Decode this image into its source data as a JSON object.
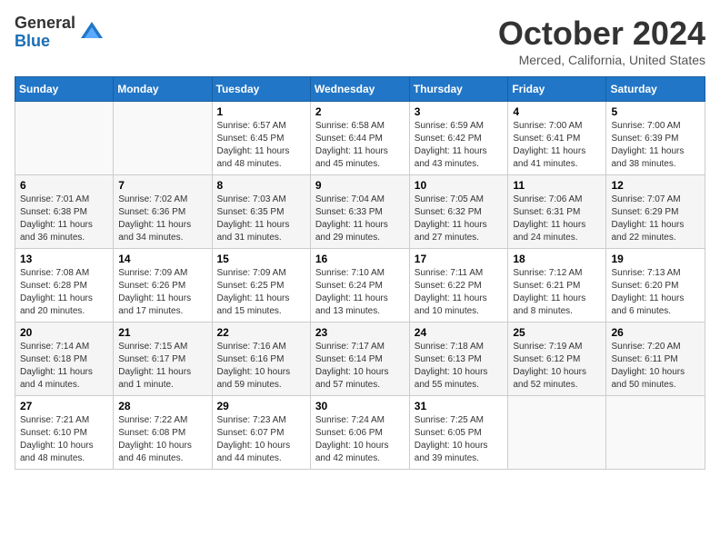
{
  "logo": {
    "general": "General",
    "blue": "Blue"
  },
  "title": "October 2024",
  "location": "Merced, California, United States",
  "weekdays": [
    "Sunday",
    "Monday",
    "Tuesday",
    "Wednesday",
    "Thursday",
    "Friday",
    "Saturday"
  ],
  "weeks": [
    [
      {
        "day": "",
        "sunrise": "",
        "sunset": "",
        "daylight": ""
      },
      {
        "day": "",
        "sunrise": "",
        "sunset": "",
        "daylight": ""
      },
      {
        "day": "1",
        "sunrise": "Sunrise: 6:57 AM",
        "sunset": "Sunset: 6:45 PM",
        "daylight": "Daylight: 11 hours and 48 minutes."
      },
      {
        "day": "2",
        "sunrise": "Sunrise: 6:58 AM",
        "sunset": "Sunset: 6:44 PM",
        "daylight": "Daylight: 11 hours and 45 minutes."
      },
      {
        "day": "3",
        "sunrise": "Sunrise: 6:59 AM",
        "sunset": "Sunset: 6:42 PM",
        "daylight": "Daylight: 11 hours and 43 minutes."
      },
      {
        "day": "4",
        "sunrise": "Sunrise: 7:00 AM",
        "sunset": "Sunset: 6:41 PM",
        "daylight": "Daylight: 11 hours and 41 minutes."
      },
      {
        "day": "5",
        "sunrise": "Sunrise: 7:00 AM",
        "sunset": "Sunset: 6:39 PM",
        "daylight": "Daylight: 11 hours and 38 minutes."
      }
    ],
    [
      {
        "day": "6",
        "sunrise": "Sunrise: 7:01 AM",
        "sunset": "Sunset: 6:38 PM",
        "daylight": "Daylight: 11 hours and 36 minutes."
      },
      {
        "day": "7",
        "sunrise": "Sunrise: 7:02 AM",
        "sunset": "Sunset: 6:36 PM",
        "daylight": "Daylight: 11 hours and 34 minutes."
      },
      {
        "day": "8",
        "sunrise": "Sunrise: 7:03 AM",
        "sunset": "Sunset: 6:35 PM",
        "daylight": "Daylight: 11 hours and 31 minutes."
      },
      {
        "day": "9",
        "sunrise": "Sunrise: 7:04 AM",
        "sunset": "Sunset: 6:33 PM",
        "daylight": "Daylight: 11 hours and 29 minutes."
      },
      {
        "day": "10",
        "sunrise": "Sunrise: 7:05 AM",
        "sunset": "Sunset: 6:32 PM",
        "daylight": "Daylight: 11 hours and 27 minutes."
      },
      {
        "day": "11",
        "sunrise": "Sunrise: 7:06 AM",
        "sunset": "Sunset: 6:31 PM",
        "daylight": "Daylight: 11 hours and 24 minutes."
      },
      {
        "day": "12",
        "sunrise": "Sunrise: 7:07 AM",
        "sunset": "Sunset: 6:29 PM",
        "daylight": "Daylight: 11 hours and 22 minutes."
      }
    ],
    [
      {
        "day": "13",
        "sunrise": "Sunrise: 7:08 AM",
        "sunset": "Sunset: 6:28 PM",
        "daylight": "Daylight: 11 hours and 20 minutes."
      },
      {
        "day": "14",
        "sunrise": "Sunrise: 7:09 AM",
        "sunset": "Sunset: 6:26 PM",
        "daylight": "Daylight: 11 hours and 17 minutes."
      },
      {
        "day": "15",
        "sunrise": "Sunrise: 7:09 AM",
        "sunset": "Sunset: 6:25 PM",
        "daylight": "Daylight: 11 hours and 15 minutes."
      },
      {
        "day": "16",
        "sunrise": "Sunrise: 7:10 AM",
        "sunset": "Sunset: 6:24 PM",
        "daylight": "Daylight: 11 hours and 13 minutes."
      },
      {
        "day": "17",
        "sunrise": "Sunrise: 7:11 AM",
        "sunset": "Sunset: 6:22 PM",
        "daylight": "Daylight: 11 hours and 10 minutes."
      },
      {
        "day": "18",
        "sunrise": "Sunrise: 7:12 AM",
        "sunset": "Sunset: 6:21 PM",
        "daylight": "Daylight: 11 hours and 8 minutes."
      },
      {
        "day": "19",
        "sunrise": "Sunrise: 7:13 AM",
        "sunset": "Sunset: 6:20 PM",
        "daylight": "Daylight: 11 hours and 6 minutes."
      }
    ],
    [
      {
        "day": "20",
        "sunrise": "Sunrise: 7:14 AM",
        "sunset": "Sunset: 6:18 PM",
        "daylight": "Daylight: 11 hours and 4 minutes."
      },
      {
        "day": "21",
        "sunrise": "Sunrise: 7:15 AM",
        "sunset": "Sunset: 6:17 PM",
        "daylight": "Daylight: 11 hours and 1 minute."
      },
      {
        "day": "22",
        "sunrise": "Sunrise: 7:16 AM",
        "sunset": "Sunset: 6:16 PM",
        "daylight": "Daylight: 10 hours and 59 minutes."
      },
      {
        "day": "23",
        "sunrise": "Sunrise: 7:17 AM",
        "sunset": "Sunset: 6:14 PM",
        "daylight": "Daylight: 10 hours and 57 minutes."
      },
      {
        "day": "24",
        "sunrise": "Sunrise: 7:18 AM",
        "sunset": "Sunset: 6:13 PM",
        "daylight": "Daylight: 10 hours and 55 minutes."
      },
      {
        "day": "25",
        "sunrise": "Sunrise: 7:19 AM",
        "sunset": "Sunset: 6:12 PM",
        "daylight": "Daylight: 10 hours and 52 minutes."
      },
      {
        "day": "26",
        "sunrise": "Sunrise: 7:20 AM",
        "sunset": "Sunset: 6:11 PM",
        "daylight": "Daylight: 10 hours and 50 minutes."
      }
    ],
    [
      {
        "day": "27",
        "sunrise": "Sunrise: 7:21 AM",
        "sunset": "Sunset: 6:10 PM",
        "daylight": "Daylight: 10 hours and 48 minutes."
      },
      {
        "day": "28",
        "sunrise": "Sunrise: 7:22 AM",
        "sunset": "Sunset: 6:08 PM",
        "daylight": "Daylight: 10 hours and 46 minutes."
      },
      {
        "day": "29",
        "sunrise": "Sunrise: 7:23 AM",
        "sunset": "Sunset: 6:07 PM",
        "daylight": "Daylight: 10 hours and 44 minutes."
      },
      {
        "day": "30",
        "sunrise": "Sunrise: 7:24 AM",
        "sunset": "Sunset: 6:06 PM",
        "daylight": "Daylight: 10 hours and 42 minutes."
      },
      {
        "day": "31",
        "sunrise": "Sunrise: 7:25 AM",
        "sunset": "Sunset: 6:05 PM",
        "daylight": "Daylight: 10 hours and 39 minutes."
      },
      {
        "day": "",
        "sunrise": "",
        "sunset": "",
        "daylight": ""
      },
      {
        "day": "",
        "sunrise": "",
        "sunset": "",
        "daylight": ""
      }
    ]
  ]
}
